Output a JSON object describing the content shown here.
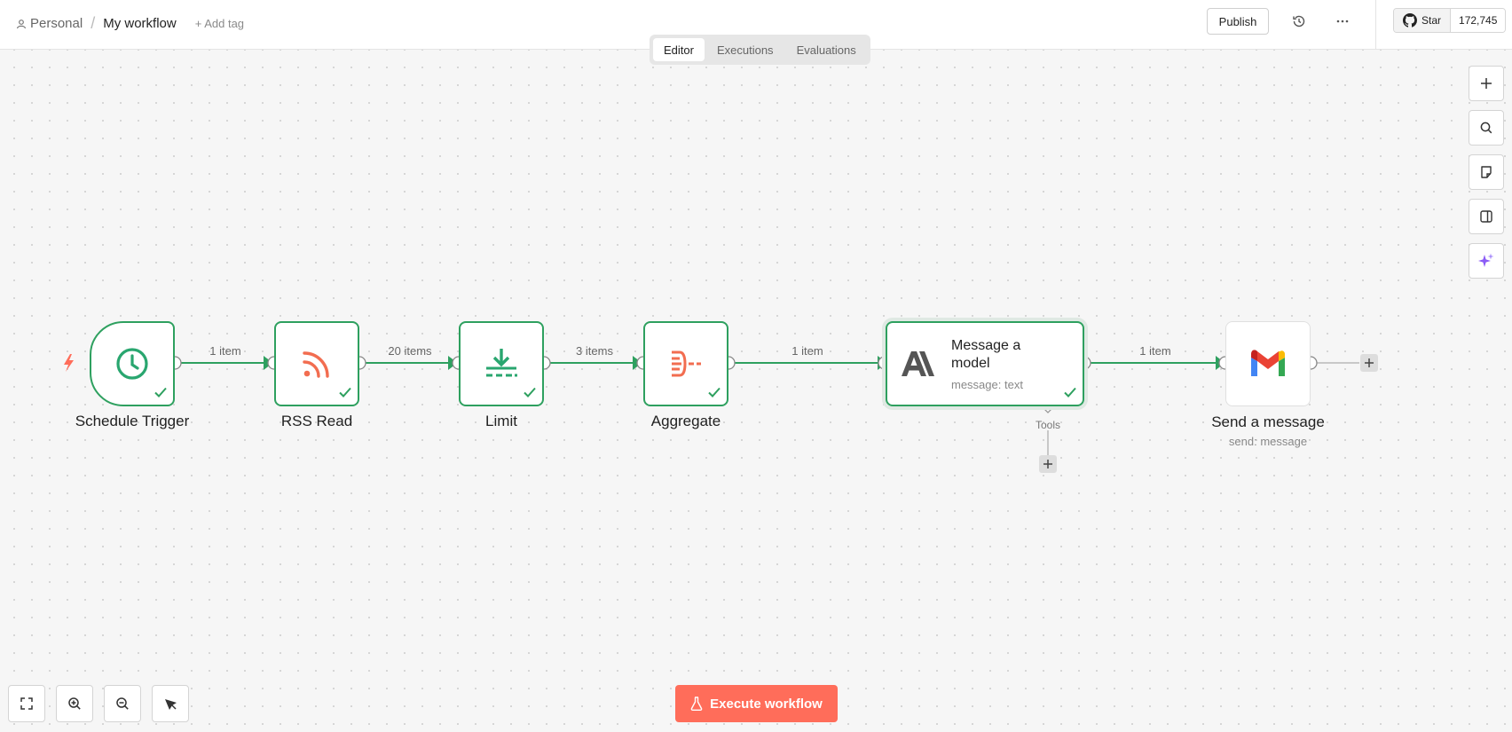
{
  "header": {
    "project": "Personal",
    "separator": "/",
    "workflow_name": "My workflow",
    "add_tag": "+ Add tag",
    "publish": "Publish",
    "github_star": "Star",
    "github_count": "172,745"
  },
  "tabs": [
    {
      "label": "Editor",
      "active": true
    },
    {
      "label": "Executions",
      "active": false
    },
    {
      "label": "Evaluations",
      "active": false
    }
  ],
  "nodes": [
    {
      "label": "Schedule Trigger",
      "icon": "clock-icon",
      "color": "#29a66f"
    },
    {
      "label": "RSS Read",
      "icon": "rss-icon",
      "color": "#f26d50"
    },
    {
      "label": "Limit",
      "icon": "limit-icon",
      "color": "#29a66f"
    },
    {
      "label": "Aggregate",
      "icon": "aggregate-icon",
      "color": "#f26d50"
    },
    {
      "label": "Message a model",
      "subtitle": "message: text",
      "icon": "anthropic-icon"
    },
    {
      "label": "Send a message",
      "subtitle": "send: message",
      "icon": "gmail-icon"
    }
  ],
  "edges": [
    "1 item",
    "20 items",
    "3 items",
    "1 item",
    "1 item"
  ],
  "tools_label": "Tools",
  "execute_button": "Execute workflow",
  "colors": {
    "success": "#2ea05f",
    "accent": "#ff6d5a",
    "ai_purple": "#8b5cf6"
  }
}
